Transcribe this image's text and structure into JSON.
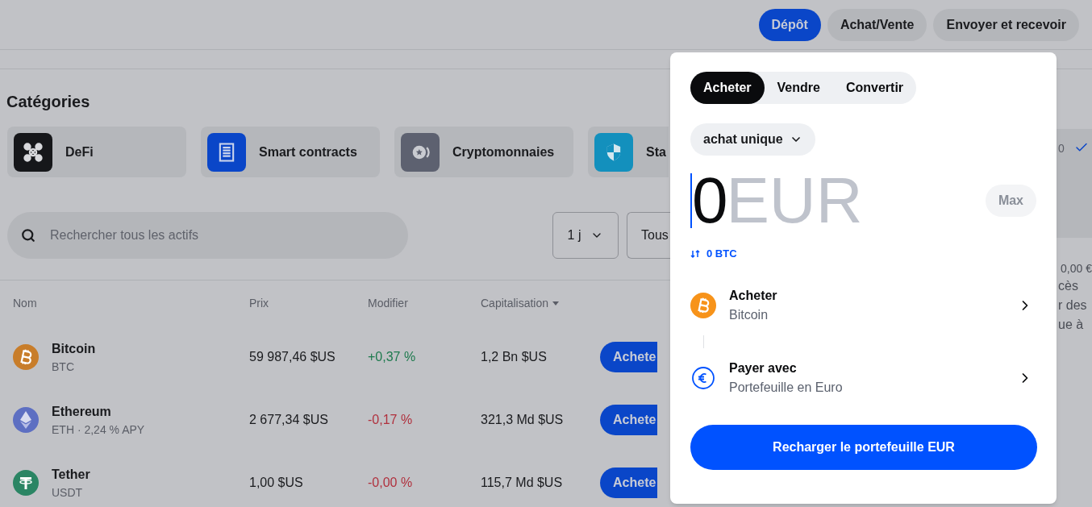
{
  "header": {
    "buttons": [
      {
        "label": "Dépôt",
        "selected": true
      },
      {
        "label": "Achat/Vente",
        "selected": false
      },
      {
        "label": "Envoyer et recevoir",
        "selected": false
      }
    ]
  },
  "categories": {
    "title": "Catégories",
    "items": [
      {
        "label": "DeFi",
        "kind": "network",
        "color": "#16171a"
      },
      {
        "label": "Smart contracts",
        "kind": "document",
        "color": "#0a46c8"
      },
      {
        "label": "Cryptomonnaies",
        "kind": "coin",
        "color": "#5d6170"
      },
      {
        "label": "Sta",
        "kind": "shield",
        "color": "#1390bd"
      }
    ]
  },
  "search": {
    "placeholder": "Rechercher tous les actifs"
  },
  "period": {
    "value": "1 j"
  },
  "filter_2": {
    "value": "Tous"
  },
  "table": {
    "columns": [
      {
        "label": "Nom",
        "sorted": false
      },
      {
        "label": "Prix",
        "sorted": false
      },
      {
        "label": "Modifier",
        "sorted": false
      },
      {
        "label": "Capitalisation",
        "sorted": true
      }
    ],
    "rows": [
      {
        "kind": "btc",
        "name": "Bitcoin",
        "symbol": "BTC",
        "price": "59 987,46 $US",
        "change": "+0,37 %",
        "color": "#1e7a4e",
        "cap": "1,2 Bn $US",
        "action": "Achete"
      },
      {
        "kind": "eth",
        "name": "Ethereum",
        "symbol": "ETH · 2,24 % APY",
        "price": "2 677,34 $US",
        "change": "-0,17 %",
        "color": "#b0303d",
        "cap": "321,3 Md $US",
        "action": "Achete"
      },
      {
        "kind": "usdt",
        "name": "Tether",
        "symbol": "USDT",
        "price": "1,00 $US",
        "change": "-0,00 %",
        "color": "#b0303d",
        "cap": "115,7 Md $US",
        "action": "Achete"
      }
    ]
  },
  "side_panel": {
    "value": "0",
    "checked": true,
    "lines": [
      "0,00 €",
      "cès",
      "r des",
      "ue à"
    ]
  },
  "trade_panel": {
    "tabs": [
      {
        "label": "Acheter",
        "selected": true
      },
      {
        "label": "Vendre",
        "selected": false
      },
      {
        "label": "Convertir",
        "selected": false
      }
    ],
    "frequency": "achat unique",
    "amount": "0",
    "currency": "EUR",
    "max": "Max",
    "conversion": "0 BTC",
    "steps": [
      {
        "kind": "btc",
        "title": "Acheter",
        "subtitle": "Bitcoin"
      },
      {
        "kind": "euro",
        "title": "Payer avec",
        "subtitle": "Portefeuille en Euro"
      }
    ],
    "submit": "Recharger le portefeuille EUR"
  }
}
